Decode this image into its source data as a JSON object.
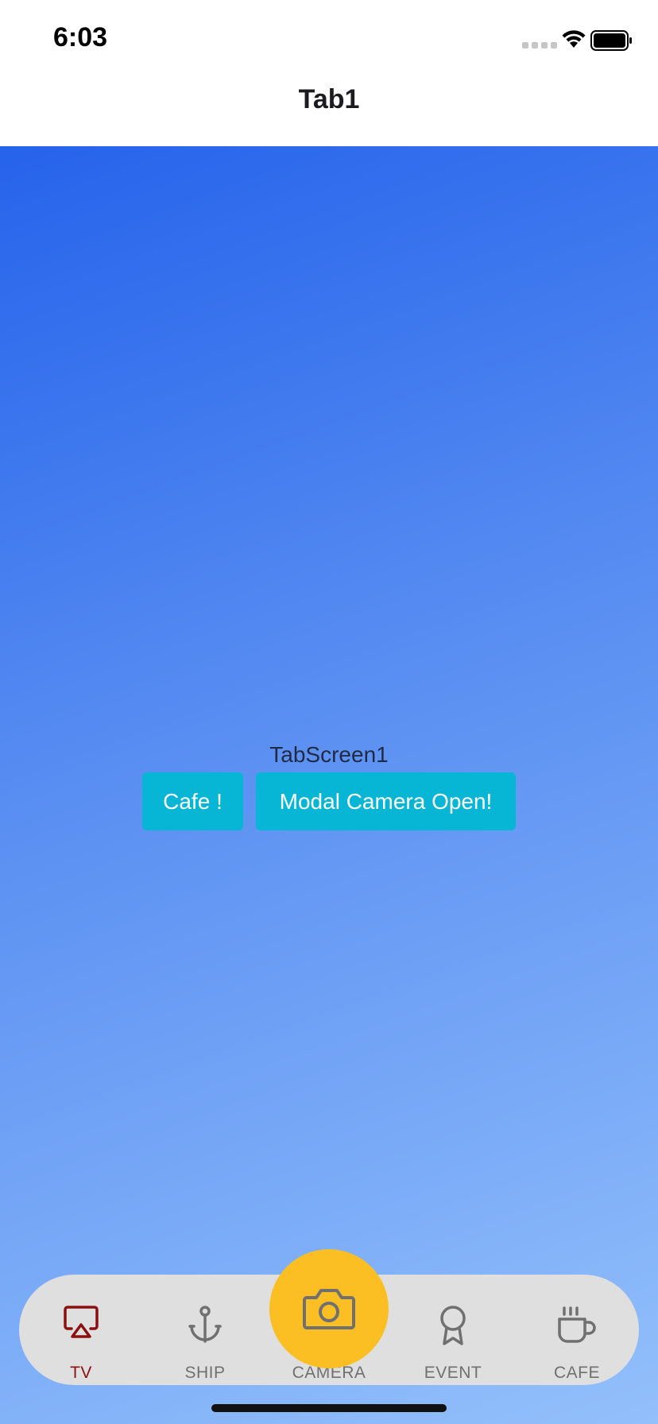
{
  "status": {
    "time": "6:03"
  },
  "nav": {
    "title": "Tab1"
  },
  "main": {
    "screen_label": "TabScreen1",
    "buttons": {
      "cafe": "Cafe !",
      "modal_camera": "Modal Camera Open!"
    }
  },
  "tabs": [
    {
      "label": "TV",
      "icon": "airplay-icon",
      "active": true
    },
    {
      "label": "SHIP",
      "icon": "anchor-icon",
      "active": false
    },
    {
      "label": "CAMERA",
      "icon": "camera-icon",
      "active": false
    },
    {
      "label": "EVENT",
      "icon": "award-icon",
      "active": false
    },
    {
      "label": "CAFE",
      "icon": "coffee-icon",
      "active": false
    }
  ],
  "colors": {
    "active_tab": "#8b1111",
    "inactive_tab": "#707070",
    "button_bg": "#06b6d4",
    "camera_fab": "#fbbf24",
    "gradient_top": "#2563eb",
    "gradient_bottom": "#93c0fb"
  }
}
